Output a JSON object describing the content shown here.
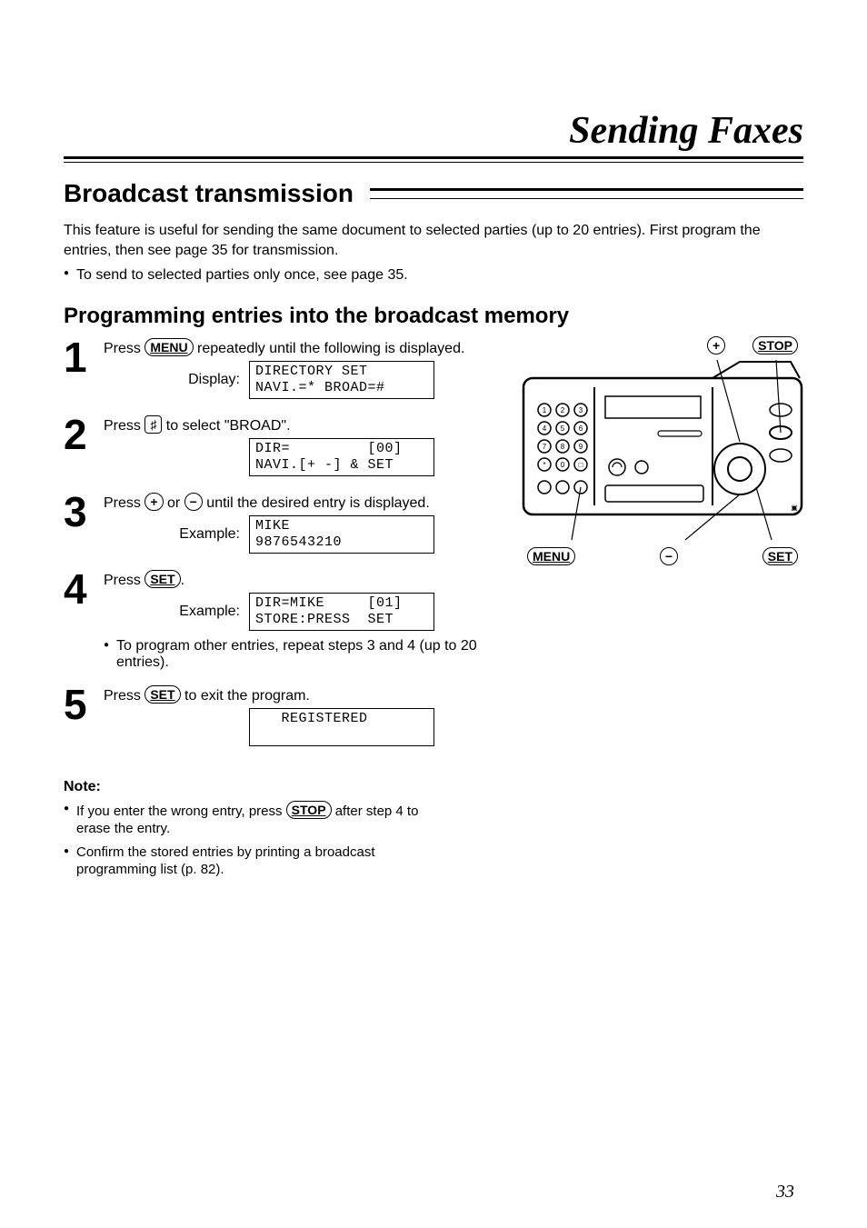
{
  "header": {
    "main_title": "Sending Faxes",
    "section_title": "Broadcast transmission",
    "intro_line1": "This feature is useful for sending the same document to selected parties (up to 20 entries). First program the entries, then see page 35 for transmission.",
    "intro_bullet": "To send to selected parties only once, see page 35.",
    "subheading": "Programming entries into the broadcast memory"
  },
  "buttons": {
    "menu": "MENU",
    "hash": "♯",
    "plus": "+",
    "minus": "−",
    "set": "SET",
    "stop": "STOP"
  },
  "steps": {
    "s1": {
      "num": "1",
      "text_a": "Press ",
      "text_b": " repeatedly until the following is displayed.",
      "display_label": "Display:",
      "lcd": "DIRECTORY SET\nNAVI.=* BROAD=#"
    },
    "s2": {
      "num": "2",
      "text_a": "Press ",
      "text_b": " to select \"BROAD\".",
      "lcd": "DIR=         [00]\nNAVI.[+ -] & SET"
    },
    "s3": {
      "num": "3",
      "text_a": "Press ",
      "text_mid": " or ",
      "text_b": " until the desired entry is displayed.",
      "display_label": "Example:",
      "lcd": "MIKE\n9876543210"
    },
    "s4": {
      "num": "4",
      "text_a": "Press ",
      "text_b": ".",
      "display_label": "Example:",
      "lcd": "DIR=MIKE     [01]\nSTORE:PRESS  SET",
      "bullet": "To program other entries, repeat steps 3 and 4 (up to 20 entries)."
    },
    "s5": {
      "num": "5",
      "text_a": "Press ",
      "text_b": " to exit the program.",
      "lcd": "   REGISTERED\n "
    }
  },
  "note": {
    "heading": "Note:",
    "item1_a": "If you enter the wrong entry, press ",
    "item1_b": " after step 4 to erase the entry.",
    "item2": "Confirm the stored entries by printing a broadcast programming list (p. 82)."
  },
  "callouts": {
    "plus": "+",
    "stop": "STOP",
    "menu": "MENU",
    "minus": "−",
    "set": "SET"
  },
  "page_number": "33"
}
